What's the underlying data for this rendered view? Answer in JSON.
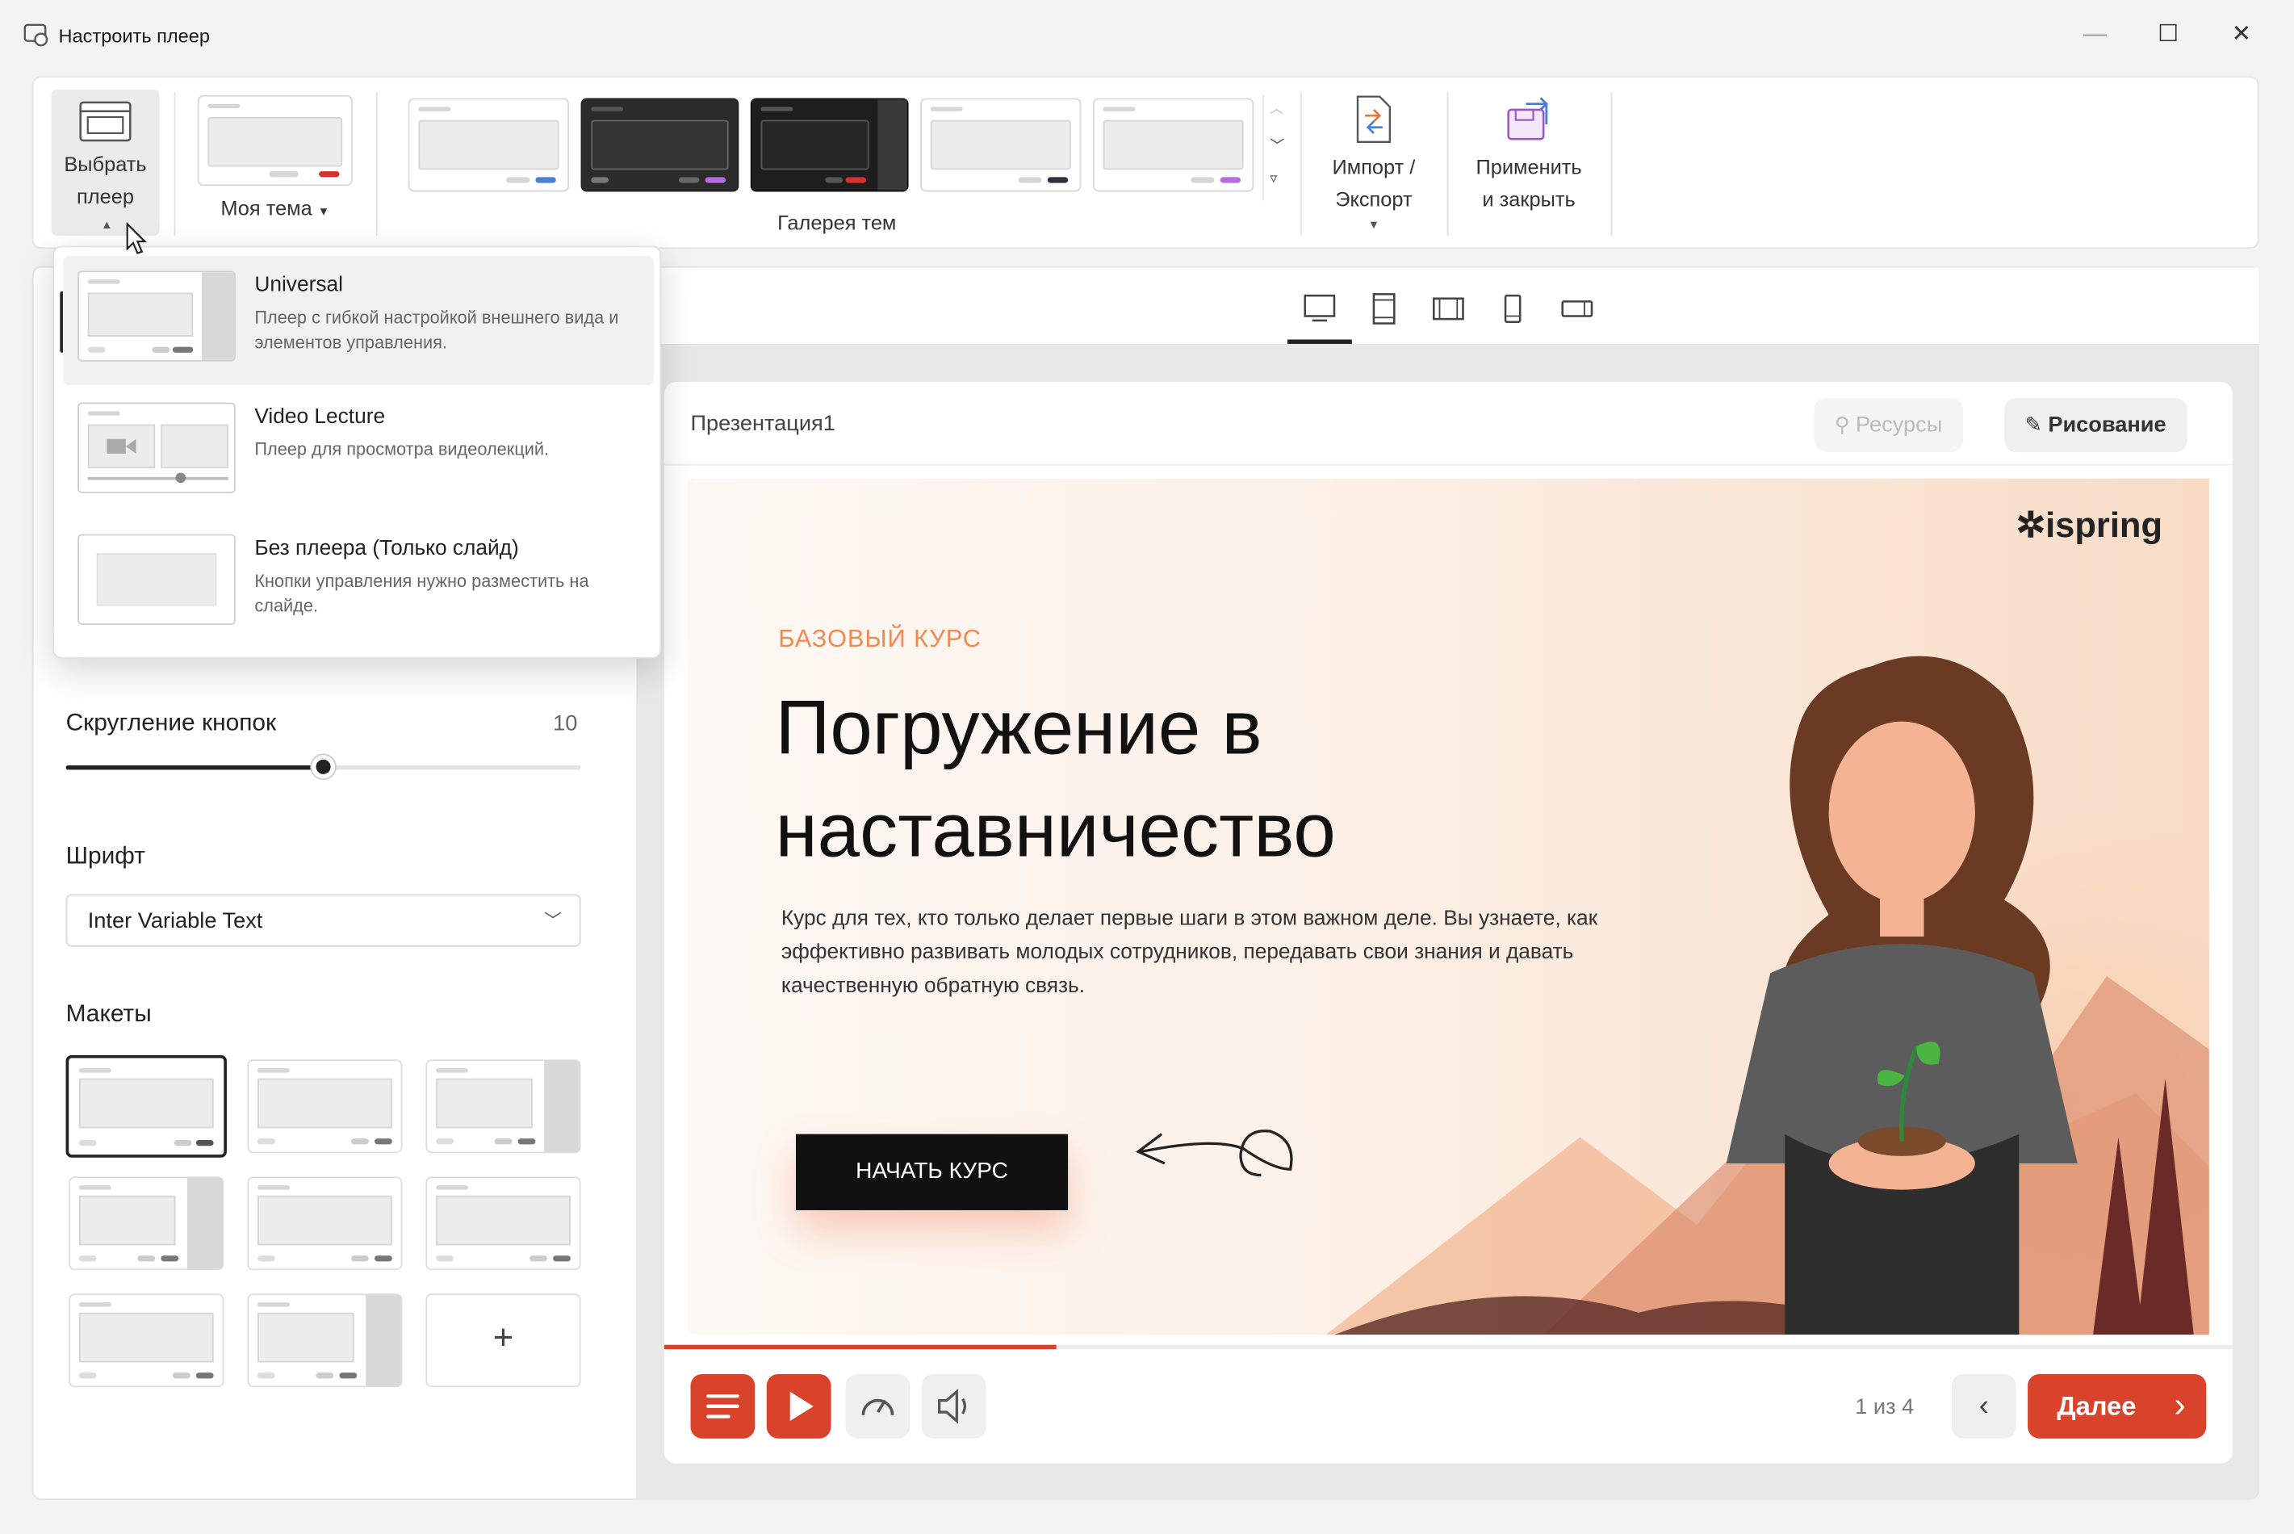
{
  "window": {
    "title": "Настроить плеер",
    "minimize": "—",
    "maximize": "☐",
    "close": "✕"
  },
  "ribbon": {
    "choose_player": [
      "Выбрать",
      "плеер"
    ],
    "my_theme": "Моя тема",
    "gallery_label": "Галерея тем",
    "import_export": [
      "Импорт /",
      "Экспорт"
    ],
    "apply_close": [
      "Применить",
      "и закрыть"
    ],
    "theme_accents": [
      "#4a7fd4",
      "#b56de0",
      "#d8302c",
      "#2b3140",
      "#b56de0"
    ]
  },
  "player_menu": {
    "items": [
      {
        "title": "Universal",
        "desc": "Плеер с гибкой настройкой внешнего вида и элементов управления."
      },
      {
        "title": "Video Lecture",
        "desc": "Плеер для просмотра видеолекций."
      },
      {
        "title": "Без плеера (Только слайд)",
        "desc": "Кнопки управления нужно разместить на слайде."
      }
    ]
  },
  "settings": {
    "rounding_label": "Скругление кнопок",
    "rounding_value": "10",
    "rounding_fraction": 0.5,
    "font_label": "Шрифт",
    "font_value": "Inter Variable Text",
    "layouts_label": "Макеты",
    "add_layout": "+"
  },
  "player": {
    "title": "Презентация1",
    "resources": "Ресурсы",
    "drawing": "Рисование",
    "counter": "1 из 4",
    "next": "Далее",
    "progress": 0.25,
    "accent": "#d9432c"
  },
  "slide": {
    "logo": "ispring",
    "eyebrow": "БАЗОВЫЙ КУРС",
    "heading_line1": "Погружение в",
    "heading_line2": "наставничество",
    "body": "Курс для тех, кто только делает первые шаги в этом важном деле. Вы узнаете, как эффективно развивать молодых сотрудников, передавать свои знания и давать качественную обратную связь.",
    "cta": "НАЧАТЬ КУРС"
  }
}
